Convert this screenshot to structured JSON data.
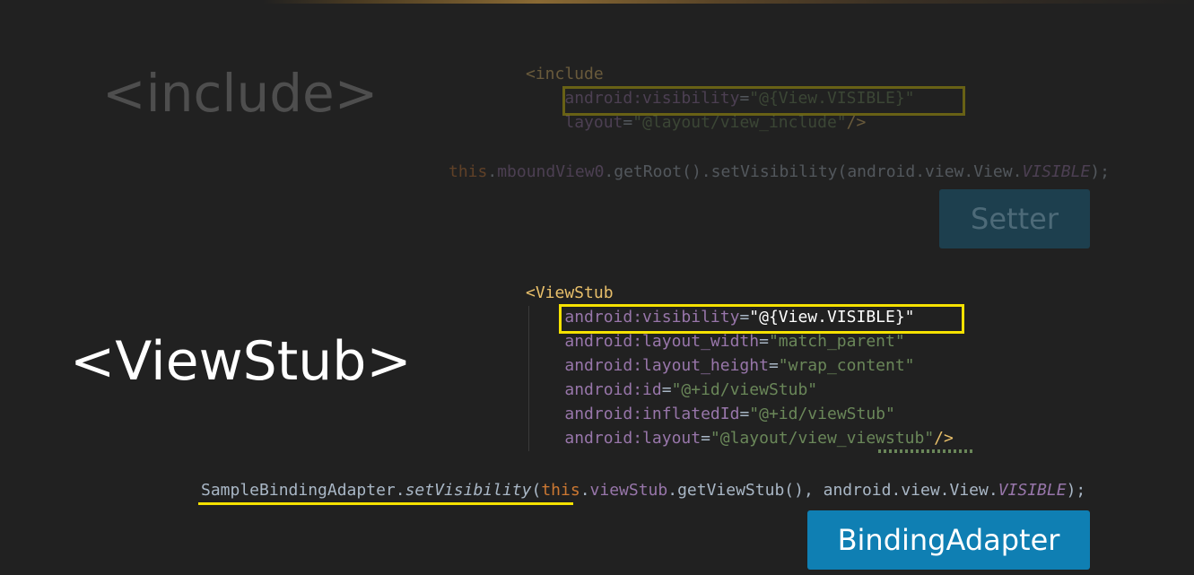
{
  "headings": {
    "include": "<include>",
    "viewstub": "<ViewStub>"
  },
  "include_code": {
    "open_tag": "<include",
    "visibility_attr": "android:visibility",
    "visibility_value": "\"@{View.VISIBLE}\"",
    "layout_attr": "layout",
    "layout_value": "\"@layout/view_include\"",
    "close": "/>",
    "generated_call": {
      "this_kw": "this",
      "field": "mboundView0",
      "rest": ".getRoot().setVisibility(android.view.View.",
      "constant": "VISIBLE",
      "end": ");"
    }
  },
  "viewstub_code": {
    "open_tag": "<ViewStub",
    "lines": [
      {
        "attr": "android:visibility",
        "value": "\"@{View.VISIBLE}\""
      },
      {
        "attr": "android:layout_width",
        "value": "\"match_parent\""
      },
      {
        "attr": "android:layout_height",
        "value": "\"wrap_content\""
      },
      {
        "attr": "android:id",
        "value": "\"@+id/viewStub\""
      },
      {
        "attr": "android:inflatedId",
        "value": "\"@+id/viewStub\""
      },
      {
        "attr": "android:layout",
        "value": "\"@layout/view_viewstub\""
      }
    ],
    "close": "/>",
    "generated_call": {
      "class_name": "SampleBindingAdapter",
      "method": "setVisibility",
      "this_kw": "this",
      "field": "viewStub",
      "rest": ".getViewStub(), android.view.View.",
      "constant": "VISIBLE",
      "end": ");"
    }
  },
  "badges": {
    "setter": "Setter",
    "binding_adapter": "BindingAdapter"
  },
  "colors": {
    "background": "#212121",
    "highlight": "#f5e100",
    "adapter_badge": "#0f7fb3",
    "setter_badge": "#1d3f4e"
  }
}
